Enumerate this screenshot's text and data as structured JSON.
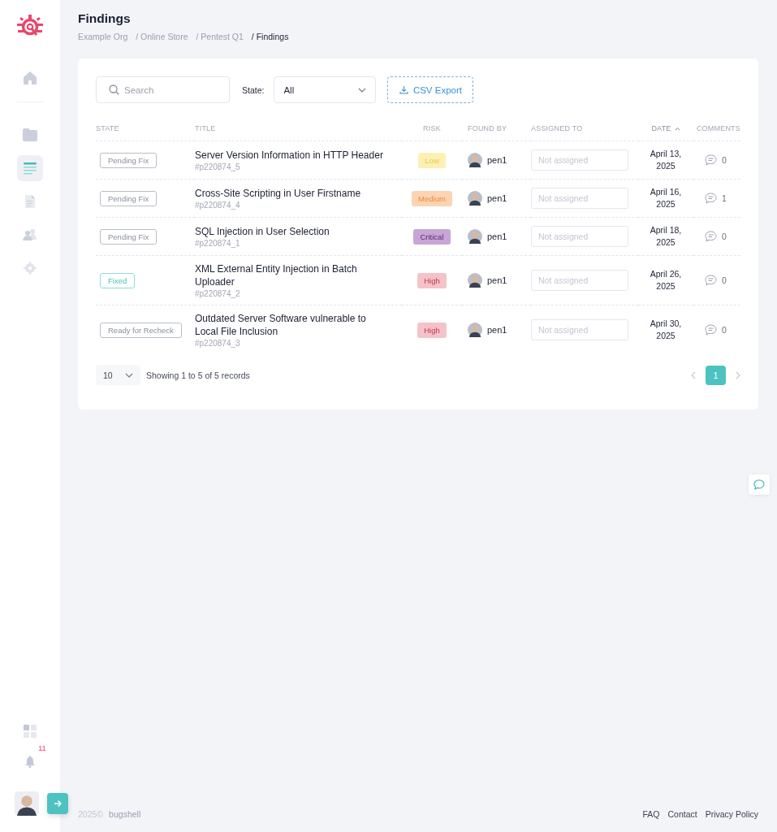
{
  "sidebar": {
    "items": [
      {
        "kind": "home",
        "selected": false
      },
      {
        "kind": "folder",
        "selected": false
      },
      {
        "kind": "list",
        "selected": true
      },
      {
        "kind": "document",
        "selected": false
      },
      {
        "kind": "people",
        "selected": false
      },
      {
        "kind": "settings",
        "selected": false
      }
    ],
    "bottom_items": [
      {
        "kind": "grid"
      },
      {
        "kind": "bell",
        "badge": "11"
      }
    ]
  },
  "page": {
    "title": "Findings",
    "breadcrumbs": [
      {
        "label": "Example Org",
        "current": false
      },
      {
        "label": "/ Online Store",
        "current": false
      },
      {
        "label": "/ Pentest Q1",
        "current": false
      },
      {
        "label": "/ Findings",
        "current": true
      }
    ]
  },
  "toolbar": {
    "search": {
      "placeholder": "Search"
    },
    "state_label": "State:",
    "state_value": "All",
    "export_button": "CSV Export"
  },
  "table": {
    "columns": [
      {
        "label": "STATE",
        "sorted": false
      },
      {
        "label": "TITLE",
        "sorted": false
      },
      {
        "label": "RISK",
        "sorted": false
      },
      {
        "label": "FOUND BY",
        "sorted": false
      },
      {
        "label": "ASSIGNED TO",
        "sorted": false
      },
      {
        "label": "DATE",
        "sorted": true
      },
      {
        "label": "COMMENTS",
        "sorted": false
      }
    ],
    "rows": [
      {
        "state": {
          "label": "Pending Fix",
          "kind": "pending"
        },
        "title": "Server Version Information in HTTP Header",
        "id": "#p220874_5",
        "risk": {
          "label": "Low",
          "kind": "low"
        },
        "found_by": "pen1",
        "assigned": {
          "placeholder": "Not assigned"
        },
        "date": "April 13, 2025",
        "comments": "0"
      },
      {
        "state": {
          "label": "Pending Fix",
          "kind": "pending"
        },
        "title": "Cross-Site Scripting in User Firstname",
        "id": "#p220874_4",
        "risk": {
          "label": "Medium",
          "kind": "medium"
        },
        "found_by": "pen1",
        "assigned": {
          "placeholder": "Not assigned"
        },
        "date": "April 16, 2025",
        "comments": "1"
      },
      {
        "state": {
          "label": "Pending Fix",
          "kind": "pending"
        },
        "title": "SQL Injection in User Selection",
        "id": "#p220874_1",
        "risk": {
          "label": "Critical",
          "kind": "critical"
        },
        "found_by": "pen1",
        "assigned": {
          "placeholder": "Not assigned"
        },
        "date": "April 18, 2025",
        "comments": "0"
      },
      {
        "state": {
          "label": "Fixed",
          "kind": "fixed"
        },
        "title": "XML External Entity Injection in Batch Uploader",
        "id": "#p220874_2",
        "risk": {
          "label": "High",
          "kind": "high"
        },
        "found_by": "pen1",
        "assigned": {
          "placeholder": "Not assigned"
        },
        "date": "April 26, 2025",
        "comments": "0"
      },
      {
        "state": {
          "label": "Ready for Recheck",
          "kind": "pending"
        },
        "title": "Outdated Server Software vulnerable to Local File Inclusion",
        "id": "#p220874_3",
        "risk": {
          "label": "High",
          "kind": "high"
        },
        "found_by": "pen1",
        "assigned": {
          "placeholder": "Not assigned"
        },
        "date": "April 30, 2025",
        "comments": "0"
      }
    ]
  },
  "pagination": {
    "page_size": "10",
    "summary": "Showing 1 to 5 of 5 records",
    "pages": [
      {
        "label": "1",
        "selected": true
      }
    ]
  },
  "footer": {
    "year": "2025©",
    "brand": "bugshell",
    "links": [
      "FAQ",
      "Contact",
      "Privacy Policy"
    ]
  }
}
